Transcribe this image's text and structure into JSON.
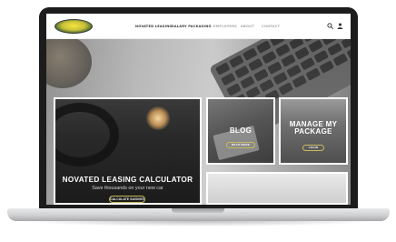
{
  "header": {
    "logo_text": "",
    "nav": [
      {
        "label": "NOVATED LEASING"
      },
      {
        "label": "SALARY PACKAGING"
      },
      {
        "label": "EMPLOYERS"
      },
      {
        "label": "ABOUT"
      },
      {
        "label": "CONTACT"
      }
    ]
  },
  "cards": {
    "calculator": {
      "title": "NOVATED LEASING CALCULATOR",
      "subtitle": "Save thousands on your new car",
      "button": "CALCULATE SAVINGS"
    },
    "blog": {
      "title": "BLOG",
      "button": "READ MORE"
    },
    "manage": {
      "title": "MANAGE MY PACKAGE",
      "button": "LOGIN"
    }
  },
  "colors": {
    "accent": "#c7b95a",
    "laptop_bezel": "#1c1c1c",
    "laptop_base": "#cfd0d2"
  },
  "icons": [
    "search-icon",
    "user-icon"
  ]
}
